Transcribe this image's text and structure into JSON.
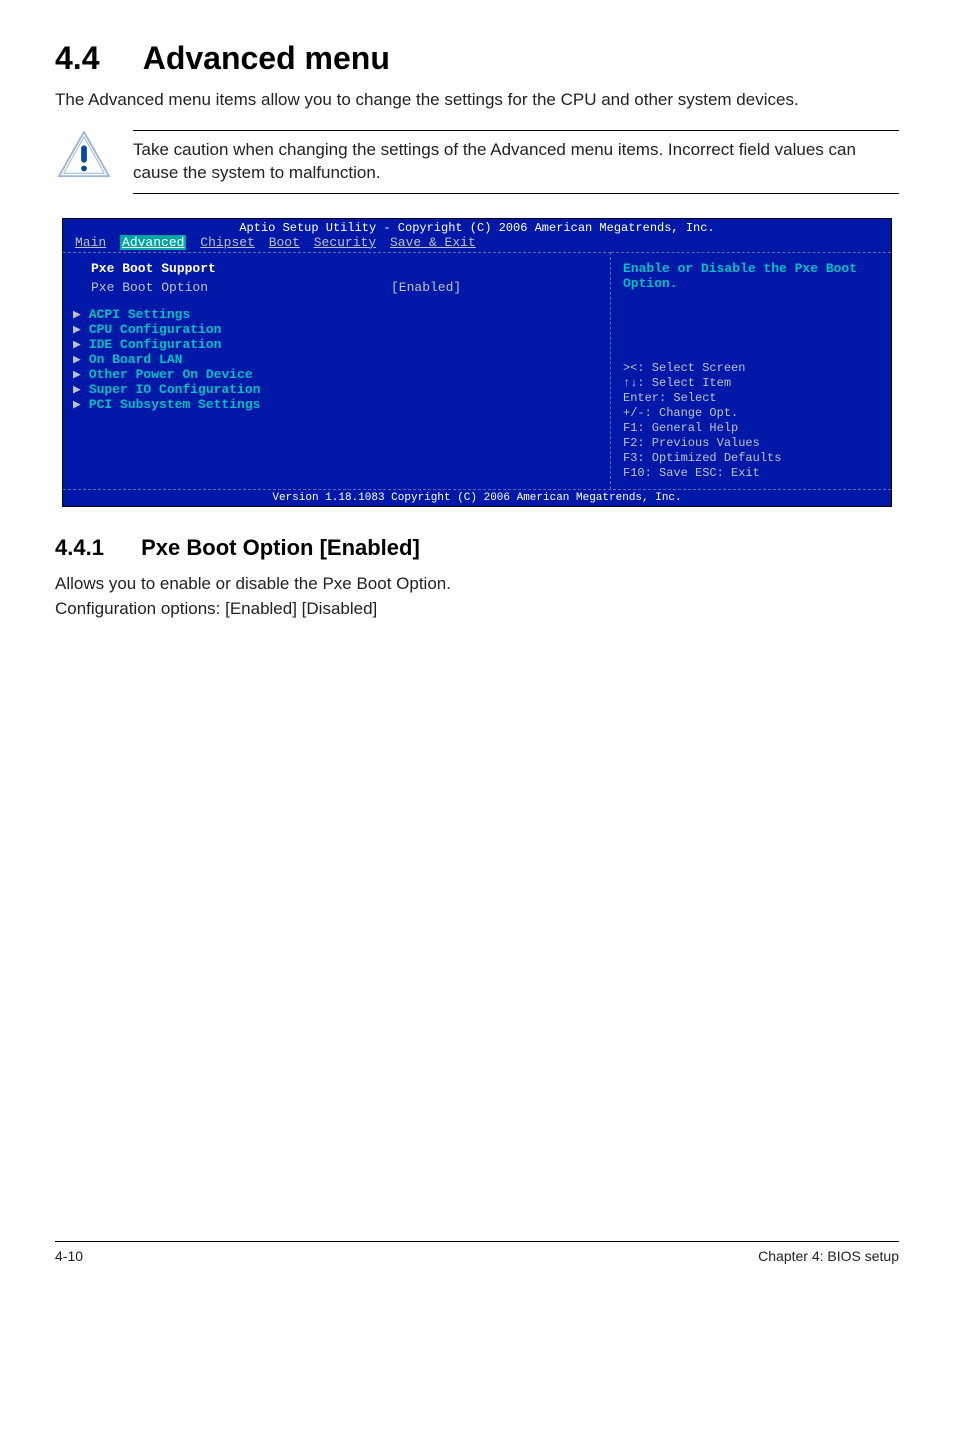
{
  "section": {
    "number": "4.4",
    "title": "Advanced menu",
    "intro": "The Advanced menu items allow you to change the settings for the CPU and other system devices.",
    "caution": "Take caution when changing the settings of the Advanced menu items. Incorrect field values can cause the system to malfunction."
  },
  "bios": {
    "header": "Aptio Setup Utility - Copyright (C) 2006 American Megatrends, Inc.",
    "menubar": {
      "items": [
        "Main",
        "Advanced",
        "Chipset",
        "Boot",
        "Security",
        "Save & Exit"
      ],
      "selected": "Advanced"
    },
    "support_label": "Pxe Boot Support",
    "option_label": "Pxe Boot Option",
    "option_value": "[Enabled]",
    "submenus": [
      "ACPI Settings",
      "CPU Configuration",
      "IDE Configuration",
      "On Board LAN",
      "Other Power On Device",
      "Super IO Configuration",
      "PCI Subsystem Settings"
    ],
    "help_text": "Enable or Disable the Pxe Boot Option.",
    "keys": [
      "><: Select Screen",
      "↑↓: Select Item",
      "Enter: Select",
      "+/-: Change Opt.",
      "F1: General Help",
      "F2: Previous Values",
      "F3: Optimized Defaults",
      "F10: Save  ESC: Exit"
    ],
    "footer": "Version 1.18.1083 Copyright (C) 2006 American Megatrends, Inc."
  },
  "subsection": {
    "number": "4.4.1",
    "title": "Pxe Boot Option [Enabled]",
    "para1": "Allows you to enable or disable the Pxe Boot Option.",
    "para2": "Configuration options: [Enabled] [Disabled]"
  },
  "page_footer": {
    "left": "4-10",
    "right": "Chapter 4: BIOS setup"
  }
}
